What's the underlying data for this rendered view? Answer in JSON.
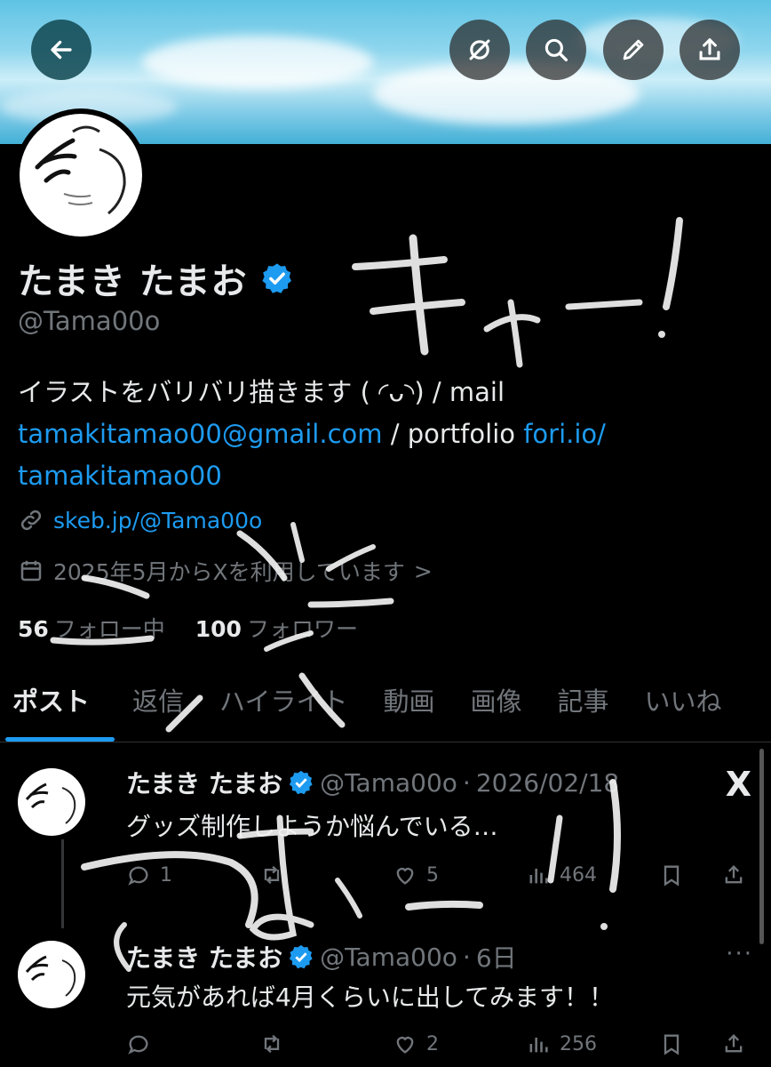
{
  "topbar": {
    "back_icon": "arrow-left-icon",
    "actions": [
      "filter-off-icon",
      "search-icon",
      "pencil-icon",
      "share-icon"
    ]
  },
  "profile": {
    "name": "たまき たまお",
    "handle": "@Tama00o",
    "bio_line1": "イラストをバリバリ描きます ( ◜ᴗ◝) / mail",
    "bio_email": "tamakitamao00@gmail.com",
    "bio_portfolio_label": " / portfolio ",
    "bio_portfolio_link_a": "fori.io/",
    "bio_portfolio_link_b": "tamakitamao00",
    "website": "skeb.jp/@Tama00o",
    "joined": "2025年5月からXを利用しています",
    "joined_chevron": ">",
    "following_count": "56",
    "following_label": "フォロー中",
    "followers_count": "100",
    "followers_label": "フォロワー"
  },
  "tabs": [
    "ポスト",
    "返信",
    "ハイライト",
    "動画",
    "画像",
    "記事",
    "いいね"
  ],
  "posts": [
    {
      "name": "たまき たまお",
      "handle": "@Tama00o",
      "sep": "·",
      "date": "2026/02/18",
      "text": "グッズ制作しようか悩んでいる…",
      "replies": "1",
      "reposts": "",
      "likes": "5",
      "views": "464"
    },
    {
      "name": "たまき たまお",
      "handle": "@Tama00o",
      "sep": "·",
      "date": "6日",
      "text": "元気があれば4月くらいに出してみます！！",
      "replies": "",
      "reposts": "",
      "likes": "2",
      "views": "256"
    }
  ],
  "xlogo": "X",
  "more": "···",
  "colors": {
    "accent": "#1d9bf0",
    "text": "#e7e9ea",
    "muted": "#71767b",
    "bg": "#000000"
  }
}
